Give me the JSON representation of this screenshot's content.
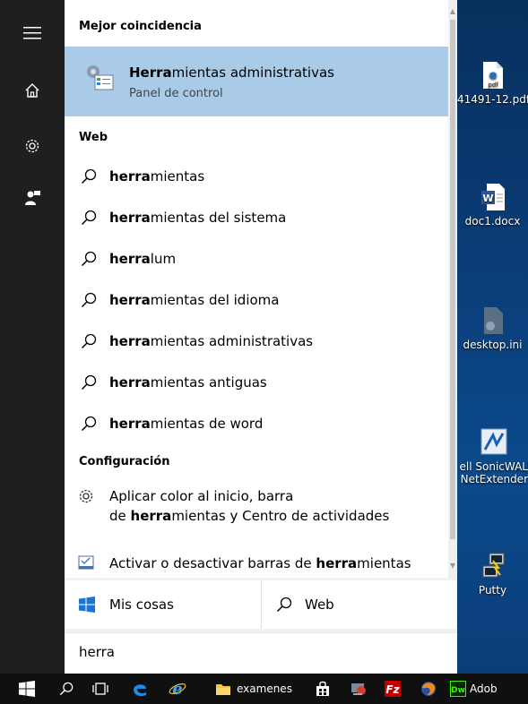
{
  "rail": {
    "items": [
      {
        "name": "hamburger-menu-icon"
      },
      {
        "name": "home-icon"
      },
      {
        "name": "gear-icon"
      },
      {
        "name": "feedback-icon"
      }
    ]
  },
  "results": {
    "best_match_header": "Mejor coincidencia",
    "best_match": {
      "title_bold": "Herra",
      "title_rest": "mientas administrativas",
      "subtitle": "Panel de control",
      "icon": "admin-tools-icon"
    },
    "web_header": "Web",
    "web_items": [
      {
        "bold": "herra",
        "rest": "mientas"
      },
      {
        "bold": "herra",
        "rest": "mientas del sistema"
      },
      {
        "bold": "herra",
        "rest": "lum"
      },
      {
        "bold": "herra",
        "rest": "mientas del idioma"
      },
      {
        "bold": "herra",
        "rest": "mientas administrativas"
      },
      {
        "bold": "herra",
        "rest": "mientas antiguas"
      },
      {
        "bold": "herra",
        "rest": "mientas de word"
      }
    ],
    "settings_header": "Configuración",
    "settings_items": [
      {
        "line1": "Aplicar color al inicio, barra",
        "line2_pre": "de ",
        "line2_bold": "herra",
        "line2_rest": "mientas y Centro de actividades",
        "icon": "gear-icon"
      },
      {
        "pre": "Activar o desactivar barras de ",
        "bold": "herra",
        "rest": "mientas",
        "icon": "toolbar-settings-icon"
      }
    ]
  },
  "tabs": {
    "my_stuff": "Mis cosas",
    "web": "Web"
  },
  "search": {
    "query": "herra"
  },
  "desktop": {
    "items": [
      {
        "label": "41491-12.pdf",
        "icon": "pdf-file-icon"
      },
      {
        "label": "doc1.docx",
        "icon": "word-document-icon"
      },
      {
        "label": "desktop.ini",
        "icon": "ini-file-icon"
      },
      {
        "label": "ell SonicWAL",
        "label2": "NetExtender",
        "icon": "netextender-icon"
      },
      {
        "label": "Putty",
        "icon": "putty-icon"
      }
    ]
  },
  "taskbar": {
    "items": [
      {
        "name": "start-button"
      },
      {
        "name": "search-icon"
      },
      {
        "name": "task-view-icon"
      },
      {
        "name": "edge-icon"
      },
      {
        "name": "internet-explorer-icon"
      },
      {
        "name": "folder-examenes",
        "label": "examenes"
      },
      {
        "name": "store-icon"
      },
      {
        "name": "app-icon"
      },
      {
        "name": "filezilla-icon"
      },
      {
        "name": "firefox-icon"
      },
      {
        "name": "dreamweaver",
        "label": "Adob"
      }
    ]
  },
  "colors": {
    "selection": "#a9cbe8",
    "rail": "#1f1f1f",
    "taskbar": "#101010",
    "desktop": "#0a3d78"
  }
}
